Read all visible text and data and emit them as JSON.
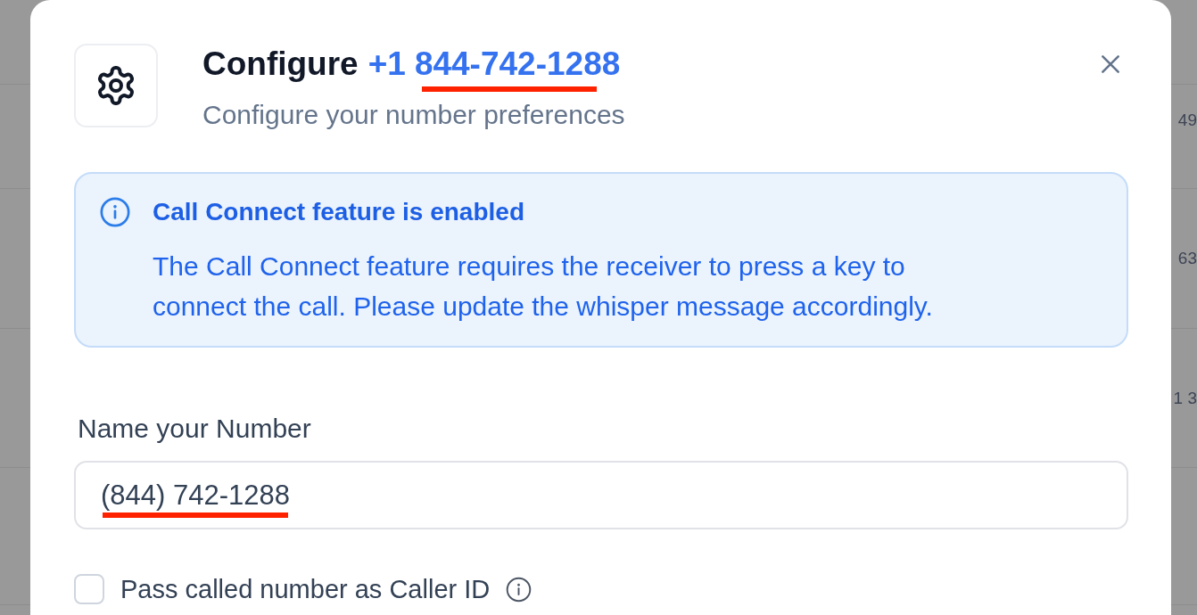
{
  "background_table": {
    "cells": [
      "49",
      "63",
      "1 3"
    ]
  },
  "dialog": {
    "title": "Configure",
    "country_code": "+1",
    "number": "844-742-1288",
    "number_underlined": true,
    "subtitle": "Configure your number preferences",
    "alert": {
      "kind": "info",
      "title": "Call Connect feature is enabled",
      "body": "The Call Connect feature requires the receiver to press a key to connect the call. Please update the whisper message accordingly."
    },
    "name_field": {
      "label": "Name your Number",
      "value": "(844) 742-1288",
      "value_underlined": true
    },
    "caller_id": {
      "label": "Pass called number as Caller ID",
      "checked": false
    }
  }
}
